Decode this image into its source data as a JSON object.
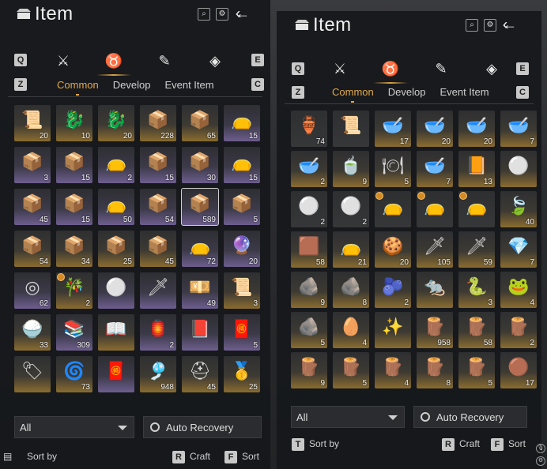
{
  "left": {
    "title": "Item",
    "keys": {
      "prev_cat": "Q",
      "next_cat": "E",
      "prev_tab": "Z",
      "next_tab": "C",
      "craft": "R",
      "sort": "F"
    },
    "categories": [
      "weapons-icon",
      "pouch-icon",
      "scroll-icon",
      "gem-icon"
    ],
    "tabs": [
      "Common",
      "Develop",
      "Event Item"
    ],
    "filter_value": "All",
    "recovery_label": "Auto Recovery",
    "sort_by_label": "Sort by",
    "craft_label": "Craft",
    "sort_label": "Sort",
    "items": [
      {
        "icon": "📜",
        "qty": "20",
        "r": "g"
      },
      {
        "icon": "🐉",
        "qty": "10",
        "r": "g"
      },
      {
        "icon": "🐉",
        "qty": "20",
        "r": "g"
      },
      {
        "icon": "📦",
        "qty": "228",
        "r": "g"
      },
      {
        "icon": "📦",
        "qty": "65",
        "r": "g"
      },
      {
        "icon": "👝",
        "qty": "15",
        "r": "p"
      },
      {
        "icon": "📦",
        "qty": "3",
        "r": "p"
      },
      {
        "icon": "📦",
        "qty": "15",
        "r": "p"
      },
      {
        "icon": "👝",
        "qty": "2",
        "r": "p"
      },
      {
        "icon": "📦",
        "qty": "15",
        "r": "p"
      },
      {
        "icon": "📦",
        "qty": "30",
        "r": "p"
      },
      {
        "icon": "👝",
        "qty": "15",
        "r": "p"
      },
      {
        "icon": "📦",
        "qty": "45",
        "r": "p"
      },
      {
        "icon": "📦",
        "qty": "15",
        "r": "p"
      },
      {
        "icon": "👝",
        "qty": "50",
        "r": "p"
      },
      {
        "icon": "📦",
        "qty": "54",
        "r": "p"
      },
      {
        "icon": "📦",
        "qty": "589",
        "r": "p",
        "sel": true
      },
      {
        "icon": "📦",
        "qty": "5",
        "r": "p"
      },
      {
        "icon": "📦",
        "qty": "54",
        "r": "g"
      },
      {
        "icon": "📦",
        "qty": "34",
        "r": "g"
      },
      {
        "icon": "📦",
        "qty": "25",
        "r": "g"
      },
      {
        "icon": "📦",
        "qty": "45",
        "r": "g"
      },
      {
        "icon": "👝",
        "qty": "72",
        "r": "p"
      },
      {
        "icon": "🔮",
        "qty": "20",
        "r": "p"
      },
      {
        "icon": "◎",
        "qty": "62",
        "r": "p"
      },
      {
        "icon": "🎋",
        "qty": "2",
        "r": "g",
        "clock": true
      },
      {
        "icon": "⚪",
        "qty": "",
        "r": "p"
      },
      {
        "icon": "🗡",
        "qty": "",
        "r": "p"
      },
      {
        "icon": "💴",
        "qty": "49",
        "r": "p"
      },
      {
        "icon": "📜",
        "qty": "3",
        "r": "g"
      },
      {
        "icon": "🍚",
        "qty": "33",
        "r": "g"
      },
      {
        "icon": "📚",
        "qty": "309",
        "r": "p"
      },
      {
        "icon": "📖",
        "qty": "",
        "r": "g"
      },
      {
        "icon": "🏮",
        "qty": "2",
        "r": "p"
      },
      {
        "icon": "📕",
        "qty": "",
        "r": "p"
      },
      {
        "icon": "🧧",
        "qty": "5",
        "r": "p"
      },
      {
        "icon": "🏷",
        "qty": "",
        "r": "g"
      },
      {
        "icon": "🌀",
        "qty": "73",
        "r": "g"
      },
      {
        "icon": "🧧",
        "qty": "",
        "r": "p"
      },
      {
        "icon": "🎐",
        "qty": "948",
        "r": "g"
      },
      {
        "icon": "⛑",
        "qty": "45",
        "r": "g"
      },
      {
        "icon": "🥇",
        "qty": "25",
        "r": "g"
      }
    ]
  },
  "right": {
    "title": "Item",
    "keys": {
      "prev_cat": "Q",
      "next_cat": "E",
      "prev_tab": "Z",
      "next_tab": "C",
      "sort_by": "T",
      "craft": "R",
      "sort": "F"
    },
    "categories": [
      "weapons-icon",
      "pouch-icon",
      "scroll-icon",
      "gem-icon"
    ],
    "tabs": [
      "Common",
      "Develop",
      "Event Item"
    ],
    "filter_value": "All",
    "recovery_label": "Auto Recovery",
    "sort_by_label": "Sort by",
    "craft_label": "Craft",
    "sort_label": "Sort",
    "items": [
      {
        "icon": "🏺",
        "qty": "74",
        "r": "n"
      },
      {
        "icon": "📜",
        "qty": "",
        "r": "n"
      },
      {
        "icon": "🥣",
        "qty": "17",
        "r": "g"
      },
      {
        "icon": "🥣",
        "qty": "20",
        "r": "g"
      },
      {
        "icon": "🥣",
        "qty": "20",
        "r": "g"
      },
      {
        "icon": "🥣",
        "qty": "7",
        "r": "g"
      },
      {
        "icon": "🥣",
        "qty": "2",
        "r": "g"
      },
      {
        "icon": "🍵",
        "qty": "9",
        "r": "g"
      },
      {
        "icon": "🍽",
        "qty": "5",
        "r": "g"
      },
      {
        "icon": "🥣",
        "qty": "7",
        "r": "g"
      },
      {
        "icon": "📙",
        "qty": "13",
        "r": "g"
      },
      {
        "icon": "⚪",
        "qty": "",
        "r": "g"
      },
      {
        "icon": "⚪",
        "qty": "2",
        "r": "n"
      },
      {
        "icon": "⚪",
        "qty": "2",
        "r": "n"
      },
      {
        "icon": "👝",
        "qty": "",
        "r": "n",
        "clock": true
      },
      {
        "icon": "👝",
        "qty": "",
        "r": "n",
        "clock": true
      },
      {
        "icon": "👝",
        "qty": "",
        "r": "n",
        "clock": true
      },
      {
        "icon": "🍃",
        "qty": "40",
        "r": "g"
      },
      {
        "icon": "🟫",
        "qty": "58",
        "r": "g"
      },
      {
        "icon": "👝",
        "qty": "21",
        "r": "g"
      },
      {
        "icon": "🍪",
        "qty": "20",
        "r": "g"
      },
      {
        "icon": "🗡",
        "qty": "105",
        "r": "g"
      },
      {
        "icon": "🗡",
        "qty": "59",
        "r": "g"
      },
      {
        "icon": "💎",
        "qty": "7",
        "r": "g"
      },
      {
        "icon": "🪨",
        "qty": "9",
        "r": "g"
      },
      {
        "icon": "🪨",
        "qty": "8",
        "r": "g"
      },
      {
        "icon": "🫐",
        "qty": "2",
        "r": "g"
      },
      {
        "icon": "🐀",
        "qty": "",
        "r": "g"
      },
      {
        "icon": "🐍",
        "qty": "3",
        "r": "g"
      },
      {
        "icon": "🐸",
        "qty": "4",
        "r": "g"
      },
      {
        "icon": "🪨",
        "qty": "5",
        "r": "g"
      },
      {
        "icon": "🥚",
        "qty": "4",
        "r": "g"
      },
      {
        "icon": "✨",
        "qty": "",
        "r": "g"
      },
      {
        "icon": "🪵",
        "qty": "958",
        "r": "g"
      },
      {
        "icon": "🪵",
        "qty": "58",
        "r": "g"
      },
      {
        "icon": "🪵",
        "qty": "2",
        "r": "g"
      },
      {
        "icon": "🪵",
        "qty": "9",
        "r": "g"
      },
      {
        "icon": "🪵",
        "qty": "5",
        "r": "g"
      },
      {
        "icon": "🪵",
        "qty": "4",
        "r": "g"
      },
      {
        "icon": "🪵",
        "qty": "8",
        "r": "g"
      },
      {
        "icon": "🪵",
        "qty": "5",
        "r": "g"
      },
      {
        "icon": "🟤",
        "qty": "17",
        "r": "g"
      }
    ]
  }
}
